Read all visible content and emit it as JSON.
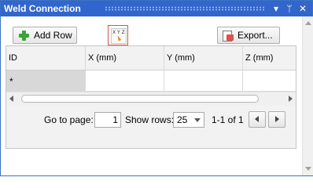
{
  "window": {
    "title": "Weld Connection",
    "controls": [
      "▾",
      "ᛘ",
      "✕"
    ]
  },
  "toolbar": {
    "add_row_label": "Add Row",
    "xyz_label": "X Y Z",
    "export_label": "Export..."
  },
  "table": {
    "columns": [
      "ID",
      "X (mm)",
      "Y (mm)",
      "Z (mm)"
    ],
    "new_row_marker": "*"
  },
  "pager": {
    "go_to_page_label": "Go to page:",
    "page_value": "1",
    "show_rows_label": "Show rows:",
    "rows_value": "25",
    "range_text": "1-1 of 1"
  },
  "icons": {
    "add": "plus-icon",
    "pick": "xyz-pick-icon",
    "export": "export-icon"
  },
  "colors": {
    "titlebar": "#3366cc",
    "accent_border": "#d9534f",
    "plus": "#3aa535"
  }
}
